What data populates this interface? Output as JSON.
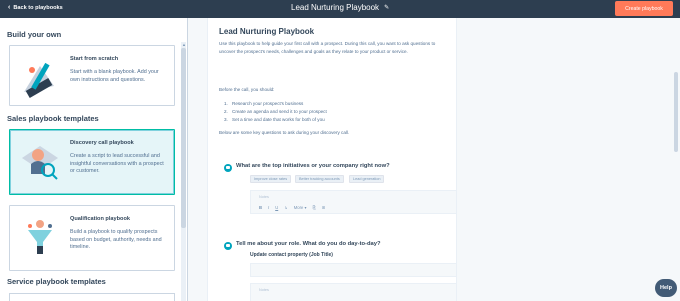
{
  "header": {
    "back_label": "Back to playbooks",
    "title": "Lead Nurturing Playbook",
    "create_label": "Create playbook"
  },
  "left": {
    "build_own_heading": "Build your own",
    "sales_heading": "Sales playbook templates",
    "service_heading": "Service playbook templates",
    "cards": [
      {
        "title": "Start from scratch",
        "desc": "Start with a blank playbook. Add your own instructions and questions."
      },
      {
        "title": "Discovery call playbook",
        "desc": "Create a script to lead successful and insightful conversations with a prospect or customer."
      },
      {
        "title": "Qualification playbook",
        "desc": "Build a playbook to qualify prospects based on budget, authority, needs and timeline."
      }
    ]
  },
  "doc": {
    "title": "Lead Nurturing Playbook",
    "intro": "Use this playbook to help guide your first call with a prospect. During this call, you want to ask questions to uncover the prospect's needs, challenges and goals as they relate to your product or service.",
    "before_call": "Before the call, you should:",
    "steps": [
      {
        "num": "1.",
        "text": "Research your prospect's business"
      },
      {
        "num": "2.",
        "text": "Create an agenda and send it to your prospect"
      },
      {
        "num": "3.",
        "text": "Set a time and date that works for both of you"
      }
    ],
    "key_questions": "Below are some key questions to ask during your discovery call.",
    "question1": "What are the top initiatives or your company right now?",
    "chips": [
      "Improve close rates",
      "Better tracking accounts",
      "Lead generation"
    ],
    "note_placeholder": "Notes",
    "toolbar": {
      "bold": "B",
      "italic": "I",
      "underline": "U",
      "link": "↳",
      "more": "More ▾",
      "attach": "⎘",
      "grid": "⊞"
    },
    "question2": "Tell me about your role. What do you do day-to-day?",
    "property_label": "Update contact property (Job Title)"
  },
  "help_label": "Help",
  "colors": {
    "header_bg": "#2d3e50",
    "accent": "#ff7a59",
    "selected_border": "#00bda5",
    "question_icon": "#00a4bd"
  }
}
